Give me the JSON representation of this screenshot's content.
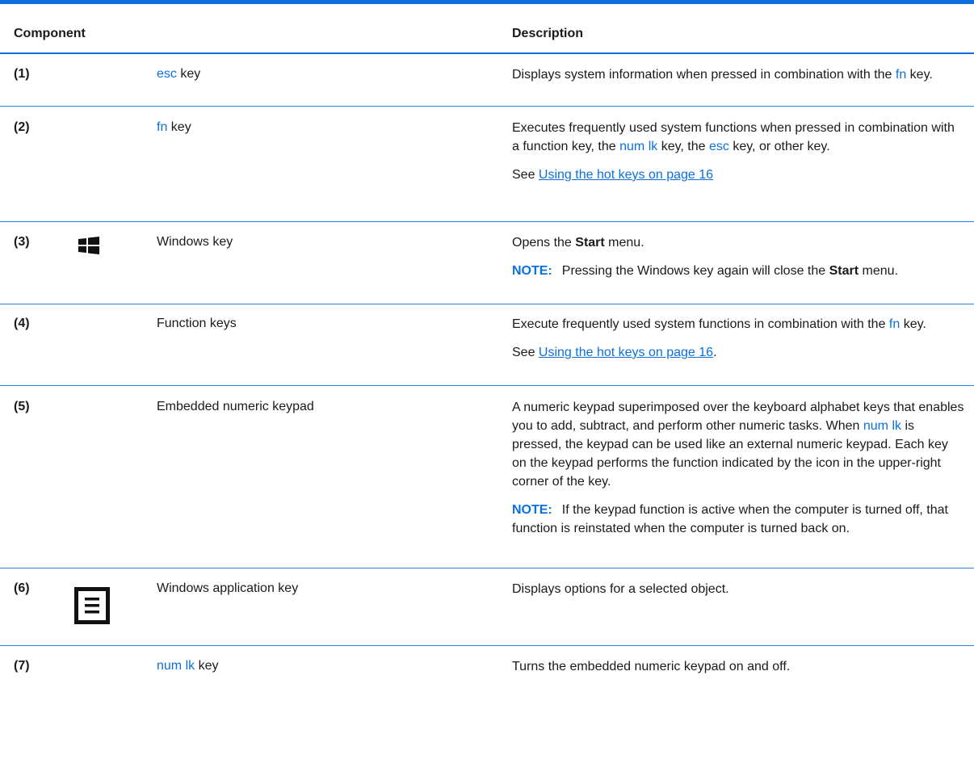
{
  "header": {
    "component": "Component",
    "description": "Description"
  },
  "rows": [
    {
      "num": "(1)",
      "comp_key": "esc",
      "comp_suffix": " key",
      "desc": {
        "a": "Displays system information when pressed in combination with the ",
        "key": "fn",
        "b": " key."
      }
    },
    {
      "num": "(2)",
      "comp_key": "fn",
      "comp_suffix": " key",
      "desc": {
        "a": "Executes frequently used system functions when pressed in combination with a function key, the ",
        "key1": "num lk",
        "b": " key, the ",
        "key2": "esc",
        "c": " key, or other key.",
        "see_prefix": "See ",
        "see_link": "Using the hot keys on page 16"
      }
    },
    {
      "num": "(3)",
      "icon": "windows-logo-icon",
      "comp": "Windows key",
      "desc": {
        "a": "Opens the ",
        "bold": "Start",
        "b": " menu.",
        "note_label": "NOTE:",
        "note_a": "Pressing the Windows key again will close the ",
        "note_bold": "Start",
        "note_b": " menu."
      }
    },
    {
      "num": "(4)",
      "comp": "Function keys",
      "desc": {
        "a": "Execute frequently used system functions in combination with the ",
        "key": "fn",
        "b": " key.",
        "see_prefix": "See ",
        "see_link": "Using the hot keys on page 16",
        "see_suffix": "."
      }
    },
    {
      "num": "(5)",
      "comp": "Embedded numeric keypad",
      "desc": {
        "a": "A numeric keypad superimposed over the keyboard alphabet keys that enables you to add, subtract, and perform other numeric tasks. When ",
        "key": "num lk",
        "b": " is pressed, the keypad can be used like an external numeric keypad. Each key on the keypad performs the function indicated by the icon in the upper-right corner of the key.",
        "note_label": "NOTE:",
        "note": "If the keypad function is active when the computer is turned off, that function is reinstated when the computer is turned back on."
      }
    },
    {
      "num": "(6)",
      "icon": "application-menu-icon",
      "comp": "Windows application key",
      "desc": {
        "a": "Displays options for a selected object."
      }
    },
    {
      "num": "(7)",
      "comp_key": "num lk",
      "comp_suffix": " key",
      "desc": {
        "a": "Turns the embedded numeric keypad on and off."
      }
    }
  ]
}
